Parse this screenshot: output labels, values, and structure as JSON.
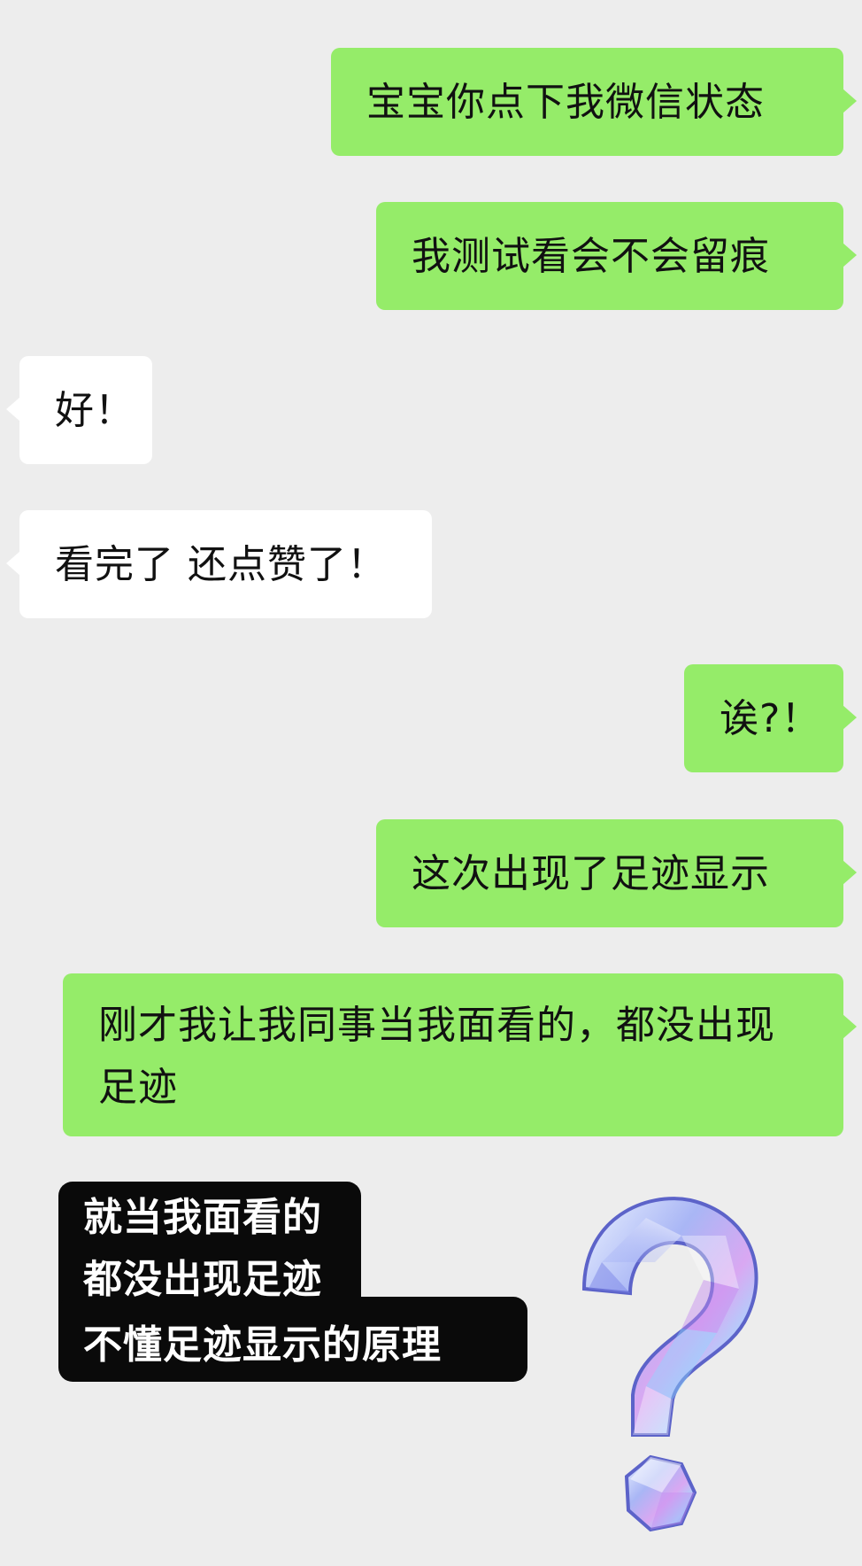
{
  "messages": [
    {
      "side": "me",
      "text": "宝宝你点下我微信状态"
    },
    {
      "side": "me",
      "text": "我测试看会不会留痕"
    },
    {
      "side": "them",
      "text": "好！"
    },
    {
      "side": "them",
      "text": "看完了 还点赞了！"
    },
    {
      "side": "me",
      "text": "诶?！"
    },
    {
      "side": "me",
      "text": "这次出现了足迹显示"
    },
    {
      "side": "me",
      "text": "刚才我让我同事当我面看的，都没出现足迹"
    }
  ],
  "caption": {
    "line1": "就当我面看的",
    "line2": "都没出现足迹",
    "line3": "不懂足迹显示的原理"
  },
  "sticker": {
    "icon": "crystal-question-mark-icon"
  },
  "colors": {
    "background": "#ededed",
    "me_bubble": "#95ec69",
    "them_bubble": "#ffffff",
    "caption_bg": "#0a0a0a"
  }
}
